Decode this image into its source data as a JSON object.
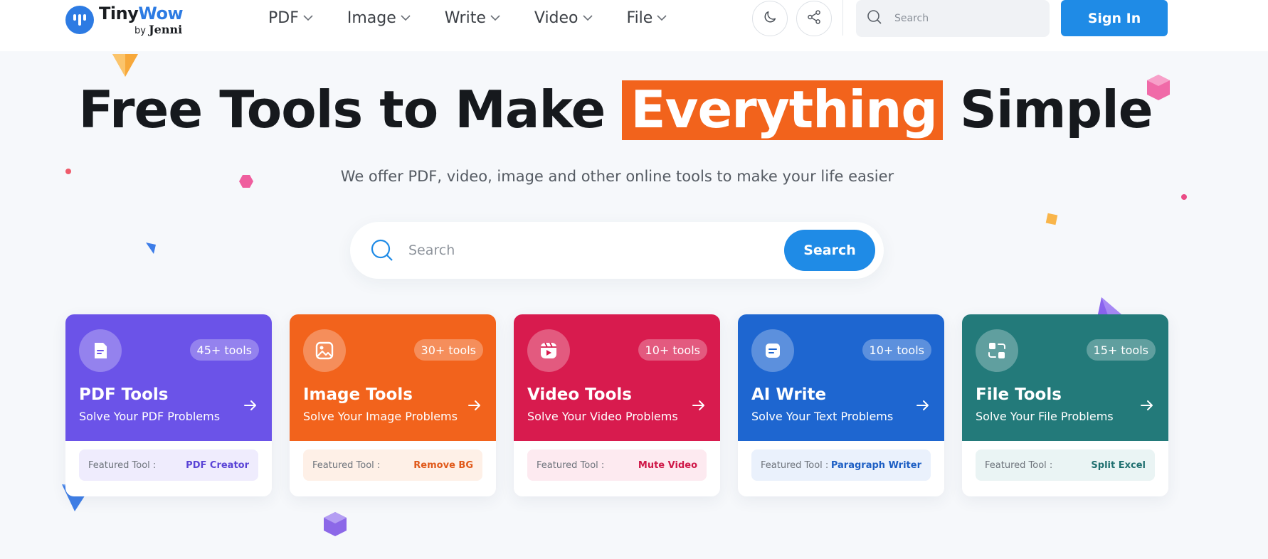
{
  "header": {
    "logo": {
      "name_part1": "Tiny",
      "name_part2": "Wow",
      "by": "by",
      "brand": "Jenni"
    },
    "nav": [
      {
        "label": "PDF"
      },
      {
        "label": "Image"
      },
      {
        "label": "Write"
      },
      {
        "label": "Video"
      },
      {
        "label": "File"
      }
    ],
    "search_placeholder": "Search",
    "signin_label": "Sign In",
    "icons": {
      "theme": "moon-icon",
      "share": "share-icon",
      "search": "search-icon"
    }
  },
  "hero": {
    "title_before": "Free Tools to Make",
    "title_highlight": "Everything",
    "title_after": "Simple",
    "subtitle": "We offer PDF, video, image and other online tools to make your life easier",
    "search_placeholder": "Search",
    "search_button": "Search",
    "highlight_color": "#f2631c"
  },
  "cards": [
    {
      "title": "PDF Tools",
      "subtitle": "Solve Your PDF Problems",
      "badge": "45+ tools",
      "featured_label": "Featured Tool :",
      "featured_value": "PDF Creator",
      "color": "#6b53e8",
      "icon": "pdf-document-icon"
    },
    {
      "title": "Image Tools",
      "subtitle": "Solve Your Image Problems",
      "badge": "30+ tools",
      "featured_label": "Featured Tool :",
      "featured_value": "Remove BG",
      "color": "#f2631c",
      "icon": "image-icon"
    },
    {
      "title": "Video Tools",
      "subtitle": "Solve Your Video Problems",
      "badge": "10+ tools",
      "featured_label": "Featured Tool :",
      "featured_value": "Mute Video",
      "color": "#d81b4e",
      "icon": "video-icon"
    },
    {
      "title": "AI Write",
      "subtitle": "Solve Your Text Problems",
      "badge": "10+ tools",
      "featured_label": "Featured Tool :",
      "featured_value": "Paragraph Writer",
      "color": "#1e66d0",
      "icon": "write-icon"
    },
    {
      "title": "File Tools",
      "subtitle": "Solve Your File Problems",
      "badge": "15+ tools",
      "featured_label": "Featured Tool :",
      "featured_value": "Split Excel",
      "color": "#237a7a",
      "icon": "file-convert-icon"
    }
  ]
}
